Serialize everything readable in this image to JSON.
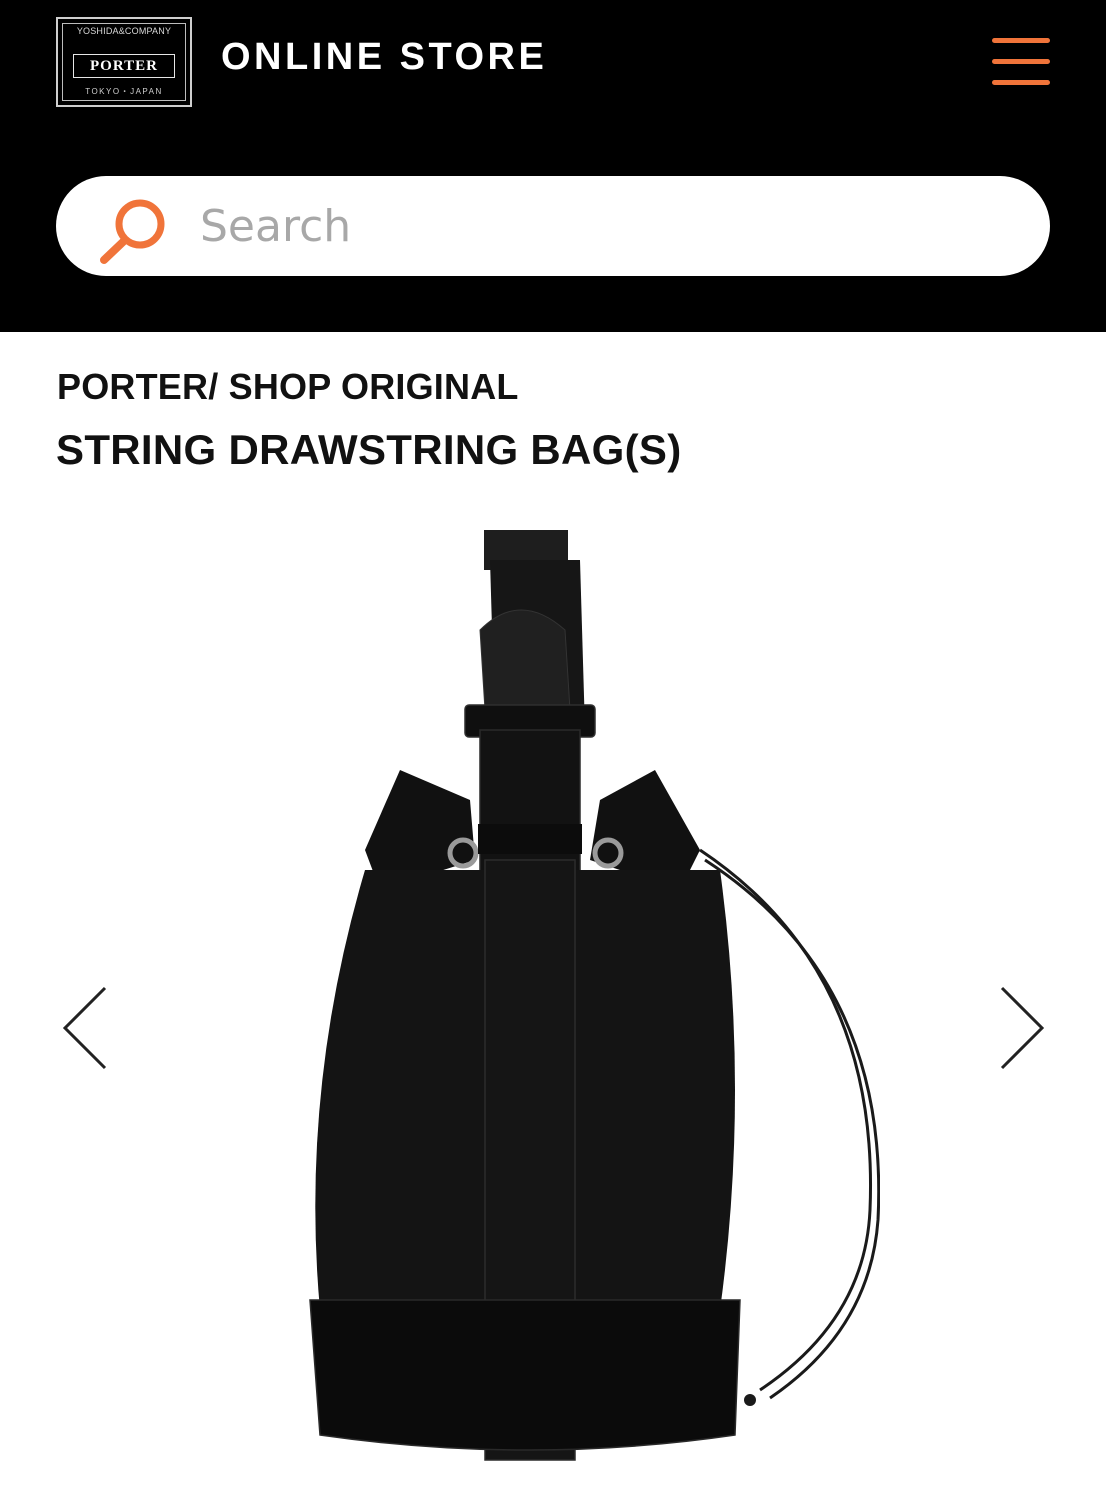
{
  "header": {
    "logo": {
      "top_text": "YOSHIDA&COMPANY",
      "brand": "PORTER",
      "bottom_text": "TOKYO・JAPAN"
    },
    "title": "ONLINE STORE",
    "menu_icon": "hamburger-menu-icon",
    "accent_color": "#f0743a",
    "background_color": "#000000"
  },
  "search": {
    "placeholder": "Search",
    "icon": "search-icon"
  },
  "product": {
    "brand_line": "PORTER/ SHOP ORIGINAL",
    "name": "STRING DRAWSTRING BAG(S)"
  },
  "gallery": {
    "prev_icon": "chevron-left-icon",
    "next_icon": "chevron-right-icon"
  }
}
